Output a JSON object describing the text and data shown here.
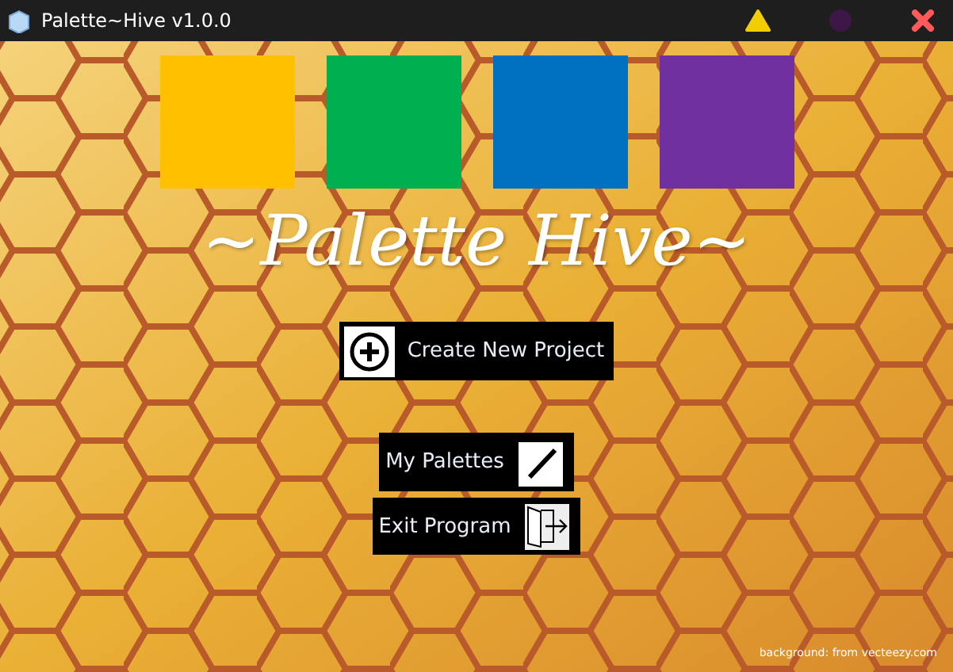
{
  "window": {
    "title": "Palette~Hive v1.0.0"
  },
  "swatches": [
    {
      "color": "#ffc000"
    },
    {
      "color": "#00b050"
    },
    {
      "color": "#0070c0"
    },
    {
      "color": "#7030a0"
    }
  ],
  "app_title": "~Palette Hive~",
  "buttons": [
    {
      "kind": "create",
      "label": "Create New Project"
    },
    {
      "kind": "palettes",
      "label": "My Palettes"
    },
    {
      "kind": "exit",
      "label": "Exit Program"
    }
  ],
  "credit": "background: from vecteezy.com"
}
